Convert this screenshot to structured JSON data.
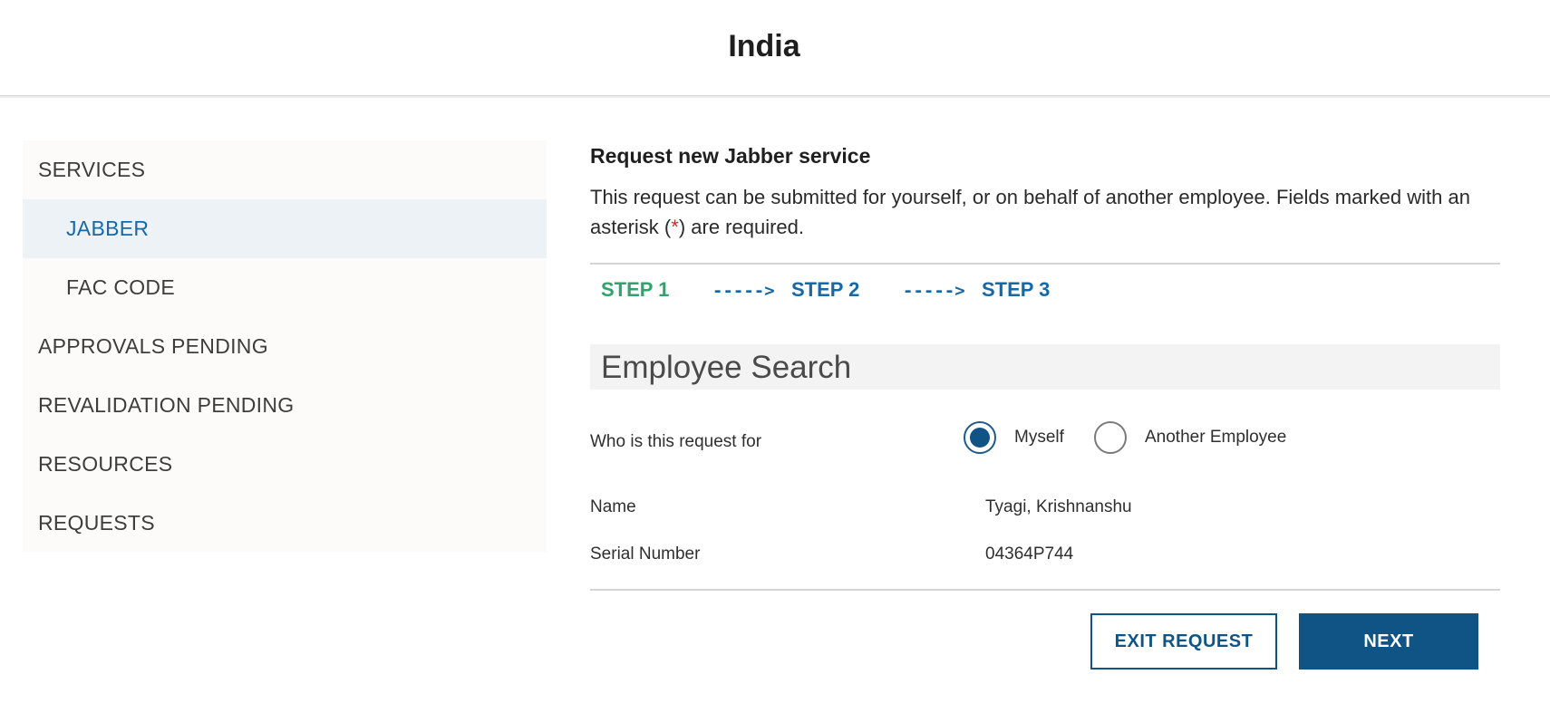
{
  "header": {
    "title": "India"
  },
  "sidebar": {
    "items": [
      {
        "label": "SERVICES"
      },
      {
        "label": "JABBER"
      },
      {
        "label": "FAC CODE"
      },
      {
        "label": "APPROVALS PENDING"
      },
      {
        "label": "REVALIDATION PENDING"
      },
      {
        "label": "RESOURCES"
      },
      {
        "label": "REQUESTS"
      }
    ]
  },
  "request": {
    "title": "Request new Jabber service",
    "desc_before": "This request can be submitted for yourself, or on behalf of another employee. Fields marked with an asterisk (",
    "asterisk": "*",
    "desc_after": ") are required."
  },
  "steps": {
    "step1": "STEP 1",
    "step2": "STEP 2",
    "step3": "STEP 3",
    "arrow": "----->"
  },
  "employee_search": {
    "title": "Employee Search",
    "who_label": "Who is this request for",
    "options": [
      {
        "label": "Myself",
        "selected": true
      },
      {
        "label": "Another Employee",
        "selected": false
      }
    ],
    "name_label": "Name",
    "name_value": "Tyagi, Krishnanshu",
    "serial_label": "Serial Number",
    "serial_value": "04364P744"
  },
  "actions": {
    "exit_label": "EXIT REQUEST",
    "next_label": "NEXT"
  },
  "colors": {
    "primary": "#0f5485",
    "link": "#1669a8",
    "step_active": "#2fa36b",
    "asterisk": "#d12c2c"
  }
}
